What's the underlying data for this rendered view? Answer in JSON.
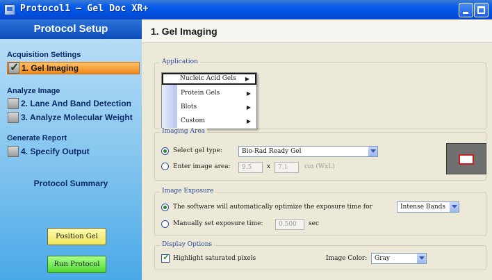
{
  "window": {
    "title": "Protocol1 – Gel Doc XR+"
  },
  "sidebar": {
    "header": "Protocol Setup",
    "sections": [
      {
        "label": "Acquisition Settings",
        "items": [
          {
            "label": "1. Gel Imaging",
            "checked": true,
            "active": true
          }
        ]
      },
      {
        "label": "Analyze Image",
        "items": [
          {
            "label": "2. Lane And Band Detection",
            "checked": false
          },
          {
            "label": "3. Analyze Molecular Weight",
            "checked": false
          }
        ]
      },
      {
        "label": "Generate Report",
        "items": [
          {
            "label": "4. Specify Output",
            "checked": false
          }
        ]
      }
    ],
    "summary_label": "Protocol Summary",
    "position_gel_label": "Position Gel",
    "run_protocol_label": "Run Protocol"
  },
  "main": {
    "title": "1. Gel Imaging",
    "application": {
      "group_label": "Application",
      "menu_items": [
        "Nucleic Acid Gels",
        "Protein Gels",
        "Blots",
        "Custom"
      ]
    },
    "imaging_area": {
      "group_label": "Imaging Area",
      "select_gel_label": "Select gel type:",
      "gel_type_value": "Bio-Rad Ready Gel",
      "enter_area_label": "Enter image area:",
      "width_value": "9.5",
      "times": "x",
      "height_value": "7.1",
      "unit_label": "cm (WxL)"
    },
    "image_exposure": {
      "group_label": "Image Exposure",
      "auto_label": "The software will automatically optimize the exposure time for",
      "auto_value": "Intense Bands",
      "manual_label": "Manually set exposure time:",
      "manual_value": "0.500",
      "sec_label": "sec"
    },
    "display_options": {
      "group_label": "Display Options",
      "highlight_label": "Highlight saturated pixels",
      "color_label": "Image Color:",
      "color_value": "Gray"
    }
  },
  "colors": {
    "titlebar": "#0a5ee8",
    "sidebar_active": "#f08a1c",
    "run_button": "#4fd832",
    "position_button": "#f0e45a"
  },
  "icons": [
    "app-icon",
    "minimize-icon",
    "maximize-icon",
    "close-icon",
    "checkbox-icon",
    "chevron-right-icon",
    "chevron-down-icon"
  ]
}
